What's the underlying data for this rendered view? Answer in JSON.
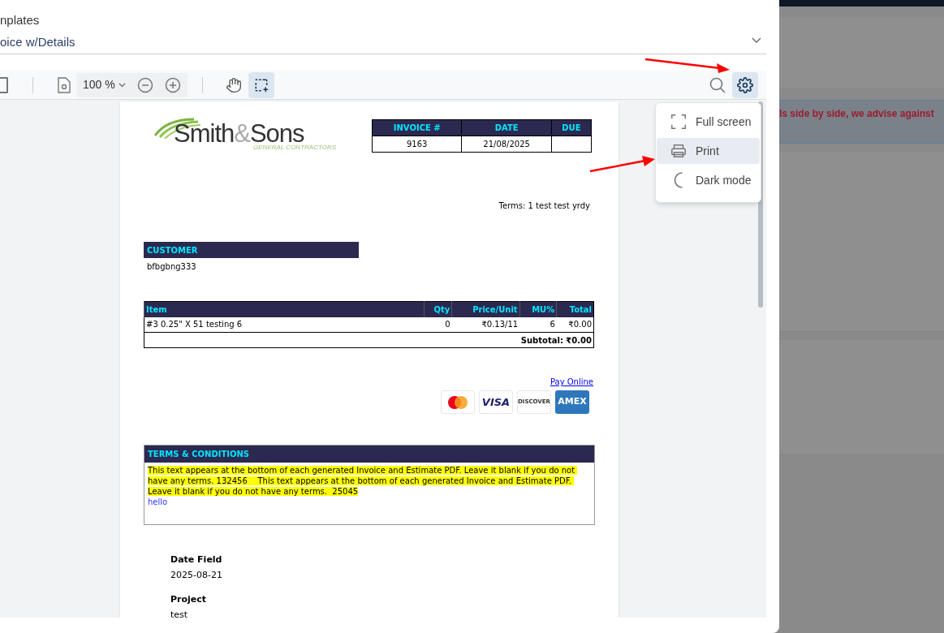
{
  "panel": {
    "title": "nplates",
    "template_select": {
      "value": "oice w/Details"
    }
  },
  "toolbar": {
    "zoom": "100 %",
    "tools": [
      {
        "kind": "hand",
        "selected": false
      },
      {
        "kind": "marquee",
        "selected": true
      }
    ],
    "settings_open": true
  },
  "menu": {
    "items": [
      {
        "kind": "fullscreen",
        "label": "Full screen",
        "selected": false
      },
      {
        "kind": "print",
        "label": "Print",
        "selected": true
      },
      {
        "kind": "dark",
        "label": "Dark mode",
        "selected": false
      }
    ]
  },
  "invoice": {
    "logo": {
      "name": "Smith",
      "amp": "&",
      "name2": "Sons",
      "tagline": "GENERAL CONTRACTORS"
    },
    "summary": {
      "columns": [
        "INVOICE #",
        "DATE",
        "DUE"
      ],
      "values": [
        "9163",
        "21/08/2025"
      ]
    },
    "terms": "Terms: 1 test test yrdy",
    "customer": {
      "heading": "CUSTOMER",
      "name": "bfbgbng333"
    },
    "items": {
      "columns": [
        "Item",
        "Qty",
        "Price/Unit",
        "MU%",
        "Total"
      ],
      "rows": [
        [
          "#3 0.25\" X 51 testing 6",
          "0",
          "₹0.13/11",
          "6",
          "₹0.00"
        ]
      ],
      "subtotal": "Subtotal: ₹0.00"
    },
    "pay_online": "Pay Online",
    "cards": [
      {
        "kind": "mastercard"
      },
      {
        "kind": "visa",
        "label": "VISA"
      },
      {
        "kind": "discover",
        "label": "DISCOVER"
      },
      {
        "kind": "amex",
        "label": "AMEX"
      }
    ],
    "conditions": {
      "heading": "TERMS & CONDITIONS",
      "text": "This text appears at the bottom of each generated Invoice and Estimate PDF. Leave it blank if you do not have any terms. 132456    This text appears at the bottom of each generated Invoice and Estimate PDF. Leave it blank if you do not have any terms.  25045",
      "link": "hello"
    },
    "fields": [
      {
        "label": "Date Field",
        "value": "2025-08-21"
      },
      {
        "label": "Project",
        "value": "test"
      }
    ]
  },
  "background": {
    "alert": "ls side by side, we advise against"
  }
}
